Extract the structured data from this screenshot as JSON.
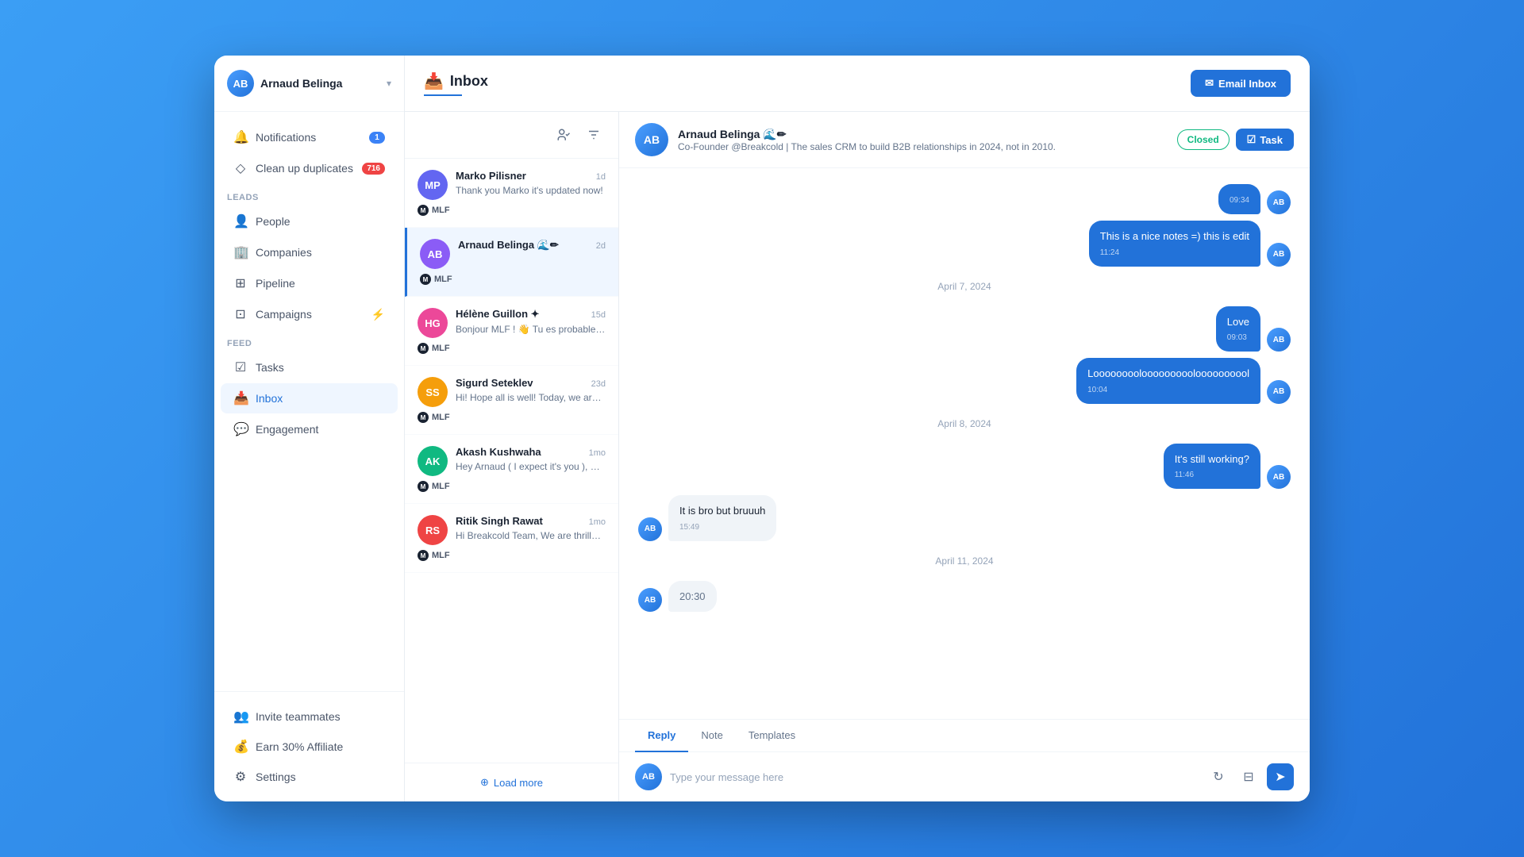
{
  "sidebar": {
    "user": {
      "name": "Arnaud Belinga",
      "initials": "AB"
    },
    "notifications": {
      "label": "Notifications",
      "badge": "1"
    },
    "cleanup": {
      "label": "Clean up duplicates",
      "badge": "716"
    },
    "sections": {
      "leads": "Leads",
      "feed": "Feed"
    },
    "items": {
      "people": "People",
      "companies": "Companies",
      "pipeline": "Pipeline",
      "campaigns": "Campaigns",
      "tasks": "Tasks",
      "inbox": "Inbox",
      "engagement": "Engagement"
    },
    "footer": {
      "invite": "Invite teammates",
      "affiliate": "Earn 30% Affiliate",
      "settings": "Settings"
    }
  },
  "header": {
    "title": "Inbox",
    "email_inbox_btn": "Email Inbox"
  },
  "conversations": [
    {
      "name": "Marko Pilisner",
      "time": "1d",
      "preview": "Thank you Marko it's updated now!",
      "tag": "MLF",
      "initials": "MP"
    },
    {
      "name": "Arnaud Belinga 🌊✏",
      "time": "2d",
      "preview": "",
      "tag": "MLF",
      "initials": "AB",
      "active": true
    },
    {
      "name": "Hélène Guillon ✦",
      "time": "15d",
      "preview": "Bonjour MLF ! 👋 Tu es probablement pas sà côté de mon offre 🦁🍪. Jette un œil...",
      "tag": "MLF",
      "initials": "HG"
    },
    {
      "name": "Sigurd Seteklev",
      "time": "23d",
      "preview": "Hi! Hope all is well! Today, we are live on ProductHunt again :) Feel free to check it ...",
      "tag": "MLF",
      "initials": "SS"
    },
    {
      "name": "Akash Kushwaha",
      "time": "1mo",
      "preview": "Hey Arnaud ( I expect it's you ), So I'm reaching here regarding LinkedIn ads, we r...",
      "tag": "MLF",
      "initials": "AK"
    },
    {
      "name": "Ritik Singh Rawat",
      "time": "1mo",
      "preview": "Hi Breakcold Team, We are thrilled to present our extensive range of services, tho...",
      "tag": "MLF",
      "initials": "RS"
    }
  ],
  "chat": {
    "contact": {
      "name": "Arnaud Belinga 🌊✏",
      "subtitle": "Co-Founder @Breakcold | The sales CRM to build B2B relationships in 2024, not in 2010.",
      "status": "Closed",
      "initials": "AB"
    },
    "messages": [
      {
        "type": "outgoing",
        "time_label": "09:34",
        "text": null,
        "is_time_only": true
      },
      {
        "type": "outgoing",
        "time_label": "11:24",
        "text": "This is a nice notes =) this is edit"
      },
      {
        "type": "date_separator",
        "text": "April 7, 2024"
      },
      {
        "type": "outgoing",
        "time_label": "09:03",
        "text": "Love"
      },
      {
        "type": "outgoing",
        "time_label": "10:04",
        "text": "Looooooooloooooooooloooooooool"
      },
      {
        "type": "date_separator",
        "text": "April 8, 2024"
      },
      {
        "type": "outgoing",
        "time_label": "11:46",
        "text": "It's still working?"
      },
      {
        "type": "incoming",
        "time_label": "15:49",
        "text": "It is bro but bruuuh",
        "initials": "AB"
      },
      {
        "type": "date_separator",
        "text": "April 11, 2024"
      },
      {
        "type": "incoming",
        "time_label": "20:30",
        "text": null,
        "is_time_only": true,
        "initials": "AB"
      }
    ],
    "compose": {
      "tabs": [
        "Reply",
        "Note",
        "Templates"
      ],
      "active_tab": "Reply",
      "placeholder": "Type your message here"
    }
  },
  "load_more": "Load more",
  "task_btn": "Task"
}
